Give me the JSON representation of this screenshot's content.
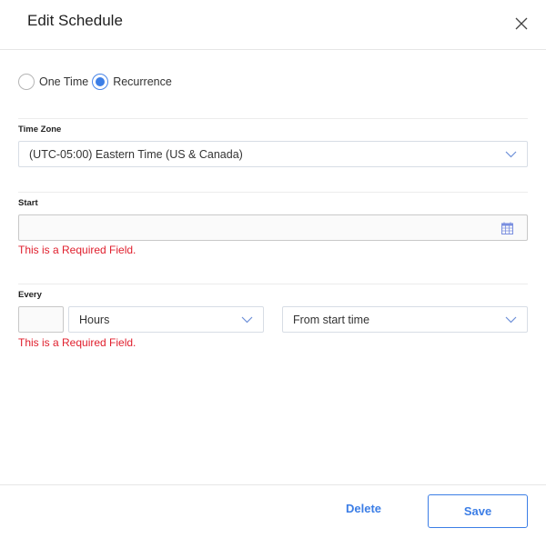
{
  "dialog": {
    "title": "Edit Schedule",
    "close_icon": "close-icon"
  },
  "schedule_type": {
    "options": [
      {
        "label": "One Time",
        "selected": false
      },
      {
        "label": "Recurrence",
        "selected": true
      }
    ]
  },
  "time_zone": {
    "label": "Time Zone",
    "value": "(UTC-05:00) Eastern Time (US & Canada)"
  },
  "start": {
    "label": "Start",
    "value": "",
    "error": "This is a Required Field.",
    "icon": "calendar-icon"
  },
  "every": {
    "label": "Every",
    "value": "",
    "unit": "Hours",
    "mode": "From start time",
    "error": "This is a Required Field."
  },
  "footer": {
    "delete_label": "Delete",
    "save_label": "Save"
  },
  "colors": {
    "accent": "#3c7ee6",
    "error": "#e0202e"
  }
}
